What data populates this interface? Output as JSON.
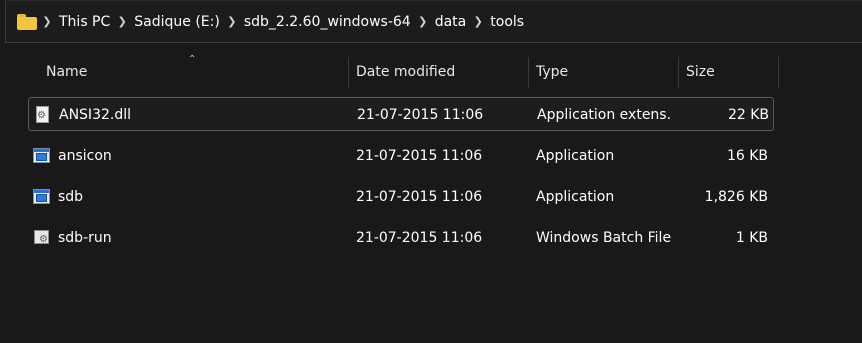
{
  "breadcrumb": [
    "This PC",
    "Sadique (E:)",
    "sdb_2.2.60_windows-64",
    "data",
    "tools"
  ],
  "icons": {
    "folder": "folder-icon",
    "separator": "chevron-right-icon",
    "sort": "sort-up-icon"
  },
  "columns": {
    "name": "Name",
    "date": "Date modified",
    "type": "Type",
    "size": "Size"
  },
  "files": [
    {
      "name": "ANSI32.dll",
      "date": "21-07-2015 11:06",
      "type": "Application extens...",
      "size": "22 KB",
      "icon": "dll-file-icon",
      "selected": true
    },
    {
      "name": "ansicon",
      "date": "21-07-2015 11:06",
      "type": "Application",
      "size": "16 KB",
      "icon": "application-icon",
      "selected": false
    },
    {
      "name": "sdb",
      "date": "21-07-2015 11:06",
      "type": "Application",
      "size": "1,826 KB",
      "icon": "application-icon",
      "selected": false
    },
    {
      "name": "sdb-run",
      "date": "21-07-2015 11:06",
      "type": "Windows Batch File",
      "size": "1 KB",
      "icon": "batch-file-icon",
      "selected": false
    }
  ],
  "colors": {
    "background": "#191919",
    "folder": "#f5c542",
    "text": "#ffffff",
    "selection_border": "#5a5a5a"
  }
}
